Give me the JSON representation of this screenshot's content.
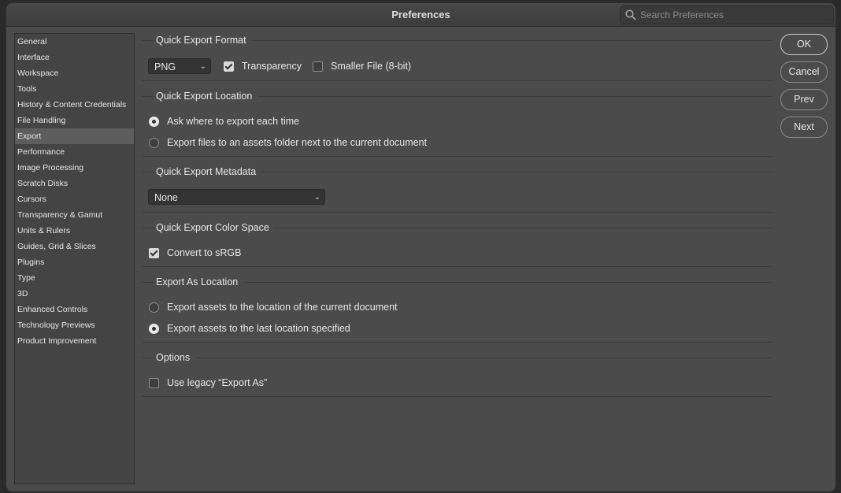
{
  "window": {
    "title": "Preferences"
  },
  "search": {
    "placeholder": "Search Preferences"
  },
  "sidebar": {
    "items": [
      {
        "label": "General"
      },
      {
        "label": "Interface"
      },
      {
        "label": "Workspace"
      },
      {
        "label": "Tools"
      },
      {
        "label": "History & Content Credentials"
      },
      {
        "label": "File Handling"
      },
      {
        "label": "Export"
      },
      {
        "label": "Performance"
      },
      {
        "label": "Image Processing"
      },
      {
        "label": "Scratch Disks"
      },
      {
        "label": "Cursors"
      },
      {
        "label": "Transparency & Gamut"
      },
      {
        "label": "Units & Rulers"
      },
      {
        "label": "Guides, Grid & Slices"
      },
      {
        "label": "Plugins"
      },
      {
        "label": "Type"
      },
      {
        "label": "3D"
      },
      {
        "label": "Enhanced Controls"
      },
      {
        "label": "Technology Previews"
      },
      {
        "label": "Product Improvement"
      }
    ],
    "selected": "Export"
  },
  "quick_export_format": {
    "title": "Quick Export Format",
    "format_value": "PNG",
    "transparency_label": "Transparency",
    "transparency_checked": true,
    "smaller_file_label": "Smaller File (8-bit)",
    "smaller_file_checked": false
  },
  "quick_export_location": {
    "title": "Quick Export Location",
    "option_ask": "Ask where to export each time",
    "option_assets": "Export files to an assets folder next to the current document",
    "selected": "option_ask"
  },
  "quick_export_metadata": {
    "title": "Quick Export Metadata",
    "value": "None"
  },
  "quick_export_color_space": {
    "title": "Quick Export Color Space",
    "convert_label": "Convert to sRGB",
    "convert_checked": true
  },
  "export_as_location": {
    "title": "Export As Location",
    "option_current": "Export assets to the location of the current document",
    "option_last": "Export assets to the last location specified",
    "selected": "option_last"
  },
  "options": {
    "title": "Options",
    "legacy_label": "Use legacy “Export As”",
    "legacy_checked": false
  },
  "buttons": {
    "ok": "OK",
    "cancel": "Cancel",
    "prev": "Prev",
    "next": "Next"
  }
}
